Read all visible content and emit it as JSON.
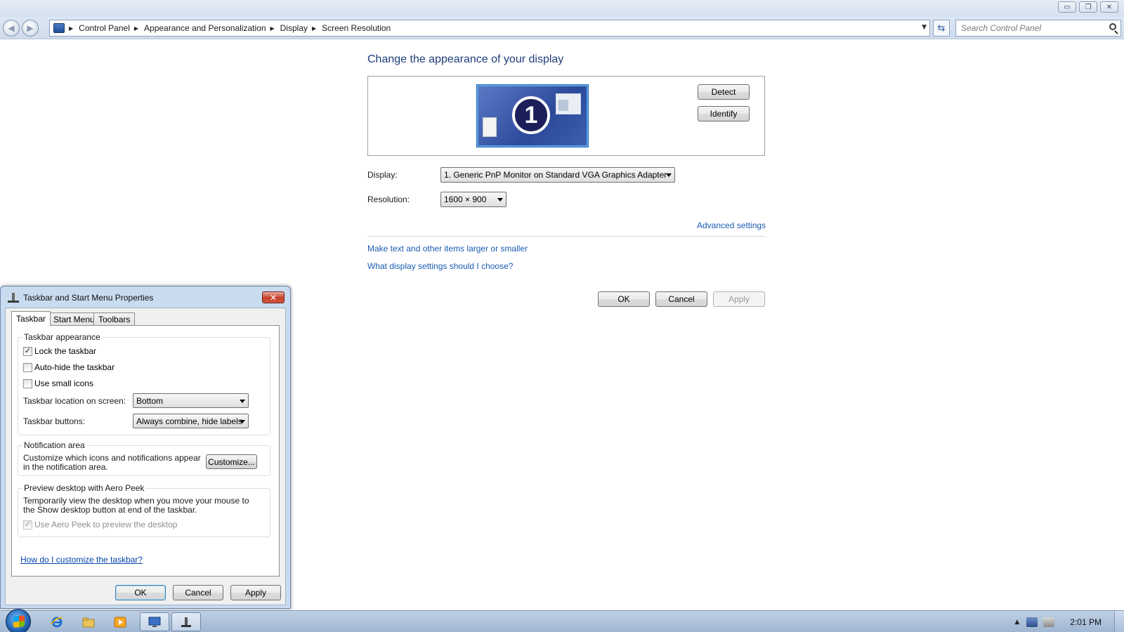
{
  "window": {
    "controls": {
      "minimize": "▭",
      "maximize": "❐",
      "close": "✕"
    }
  },
  "address": {
    "breadcrumbs": [
      "Control Panel",
      "Appearance and Personalization",
      "Display",
      "Screen Resolution"
    ],
    "search_placeholder": "Search Control Panel"
  },
  "main": {
    "title": "Change the appearance of your display",
    "monitor_number": "1",
    "detect_label": "Detect",
    "identify_label": "Identify",
    "display_label": "Display:",
    "display_value": "1. Generic PnP Monitor on Standard VGA Graphics Adapter",
    "resolution_label": "Resolution:",
    "resolution_value": "1600 × 900",
    "advanced_link": "Advanced settings",
    "link_text_size": "Make text and other items larger or smaller",
    "link_which_settings": "What display settings should I choose?",
    "ok_label": "OK",
    "cancel_label": "Cancel",
    "apply_label": "Apply"
  },
  "dialog": {
    "title": "Taskbar and Start Menu Properties",
    "tabs": [
      "Taskbar",
      "Start Menu",
      "Toolbars"
    ],
    "appearance": {
      "title": "Taskbar appearance",
      "lock": {
        "label": "Lock the taskbar",
        "checked": true
      },
      "autohide": {
        "label": "Auto-hide the taskbar",
        "checked": false
      },
      "small_icons": {
        "label": "Use small icons",
        "checked": false
      },
      "location_label": "Taskbar location on screen:",
      "location_value": "Bottom",
      "buttons_label": "Taskbar buttons:",
      "buttons_value": "Always combine, hide labels"
    },
    "notification": {
      "title": "Notification area",
      "text": "Customize which icons and notifications appear in the notification area.",
      "customize_label": "Customize..."
    },
    "peek": {
      "title": "Preview desktop with Aero Peek",
      "text": "Temporarily view the desktop when you move your mouse to the Show desktop button at end of the taskbar.",
      "checkbox_label": "Use Aero Peek to preview the desktop",
      "checked": true
    },
    "help_link": "How do I customize the taskbar?",
    "ok_label": "OK",
    "cancel_label": "Cancel",
    "apply_label": "Apply"
  },
  "taskbar": {
    "pinned": [
      "internet-explorer-icon",
      "explorer-folder-icon",
      "media-player-icon",
      "display-settings-icon",
      "taskbar-properties-icon"
    ],
    "clock": "2:01 PM"
  },
  "colors": {
    "link": "#1a5bb3",
    "title_blue": "#1e3d7b",
    "monitor_fill": "#2c4a9a"
  }
}
